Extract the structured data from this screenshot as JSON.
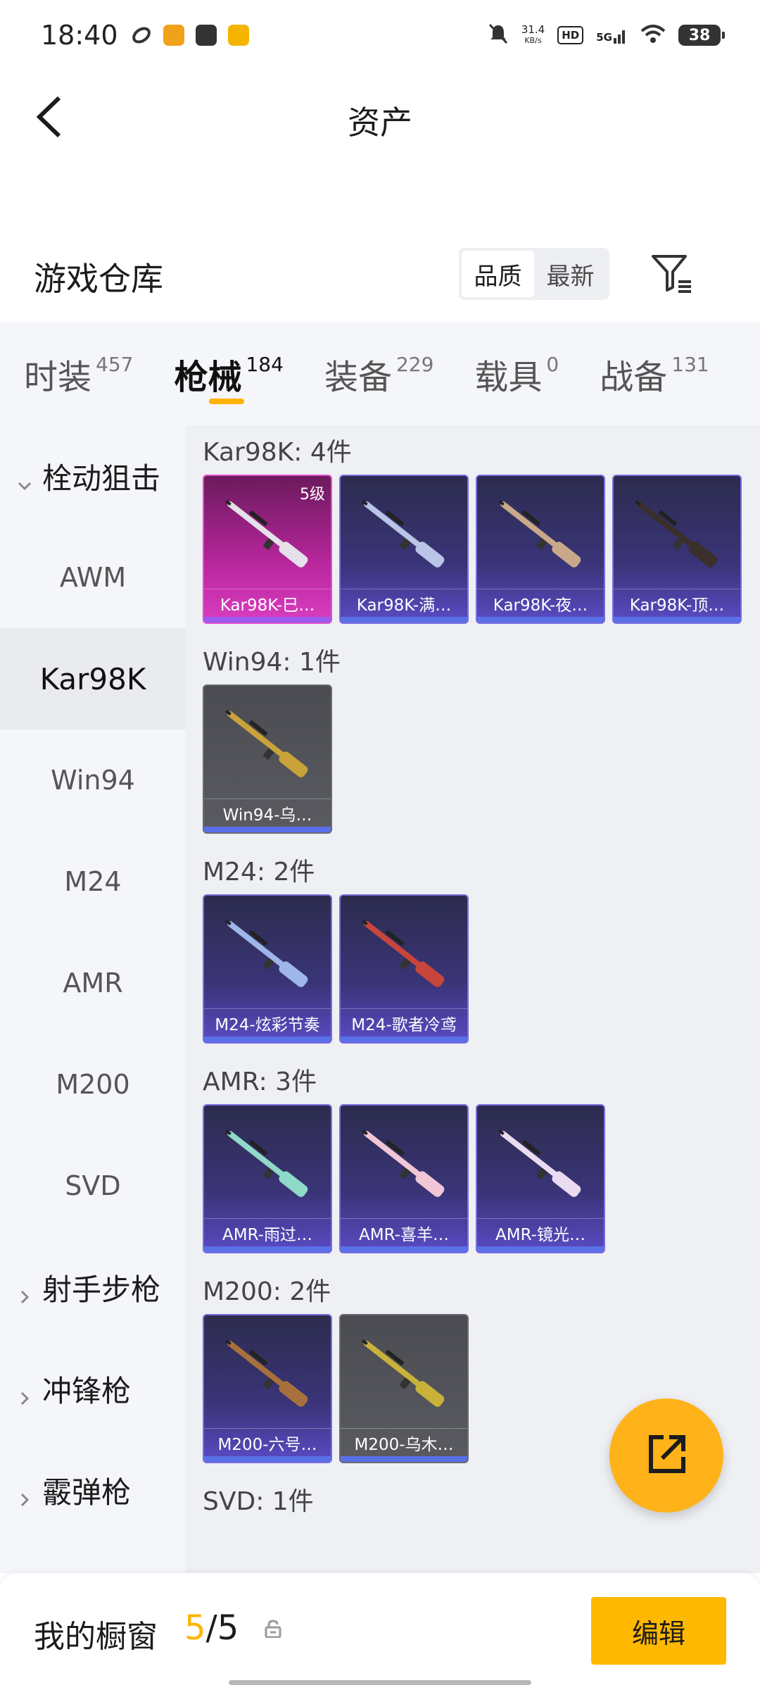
{
  "status_bar": {
    "time": "18:40",
    "speed_value": "31.4",
    "speed_unit": "KB/s",
    "hd": "HD",
    "network": "5G",
    "battery": "38"
  },
  "nav": {
    "title": "资产"
  },
  "warehouse": {
    "title": "游戏仓库",
    "sort_options": [
      "品质",
      "最新"
    ],
    "active_sort": "品质"
  },
  "categories": [
    {
      "label": "时装",
      "count": "457"
    },
    {
      "label": "枪械",
      "count": "184",
      "active": true
    },
    {
      "label": "装备",
      "count": "229"
    },
    {
      "label": "载具",
      "count": "0"
    },
    {
      "label": "战备",
      "count": "131"
    }
  ],
  "sidebar": {
    "items": [
      {
        "label": "栓动狙击",
        "group": true,
        "expanded": true
      },
      {
        "label": "AWM"
      },
      {
        "label": "Kar98K",
        "selected": true
      },
      {
        "label": "Win94"
      },
      {
        "label": "M24"
      },
      {
        "label": "AMR"
      },
      {
        "label": "M200"
      },
      {
        "label": "SVD"
      },
      {
        "label": "射手步枪",
        "group": true
      },
      {
        "label": "冲锋枪",
        "group": true
      },
      {
        "label": "霰弹枪",
        "group": true
      }
    ]
  },
  "sections": [
    {
      "title": "Kar98K: 4件",
      "items": [
        {
          "name": "Kar98K-巳…",
          "level": "5级",
          "rarity": "pink",
          "gun_color": "#e6e0ea"
        },
        {
          "name": "Kar98K-满…",
          "rarity": "purple",
          "gun_color": "#b9c4e6"
        },
        {
          "name": "Kar98K-夜…",
          "rarity": "purple",
          "gun_color": "#c9a88a"
        },
        {
          "name": "Kar98K-顶…",
          "rarity": "purple",
          "gun_color": "#3a2f2a"
        }
      ]
    },
    {
      "title": "Win94: 1件",
      "items": [
        {
          "name": "Win94-乌…",
          "rarity": "gray",
          "gun_color": "#c9a23a"
        }
      ]
    },
    {
      "title": "M24: 2件",
      "items": [
        {
          "name": "M24-炫彩节奏",
          "rarity": "purple",
          "gun_color": "#9fb6e8"
        },
        {
          "name": "M24-歌者冷鸢",
          "rarity": "purple",
          "gun_color": "#c8453c"
        }
      ]
    },
    {
      "title": "AMR: 3件",
      "items": [
        {
          "name": "AMR-雨过…",
          "rarity": "purple",
          "gun_color": "#8fd9c9"
        },
        {
          "name": "AMR-喜羊…",
          "rarity": "purple",
          "gun_color": "#f1c6d6"
        },
        {
          "name": "AMR-镜光…",
          "rarity": "purple",
          "gun_color": "#eadcf0"
        }
      ]
    },
    {
      "title": "M200: 2件",
      "items": [
        {
          "name": "M200-六号…",
          "rarity": "purple",
          "gun_color": "#a8703c"
        },
        {
          "name": "M200-乌木…",
          "rarity": "gray",
          "gun_color": "#c8b23a"
        }
      ]
    },
    {
      "title": "SVD: 1件",
      "items": []
    }
  ],
  "showcase": {
    "label": "我的橱窗",
    "current": "5",
    "separator": "/",
    "total": "5",
    "edit_label": "编辑"
  }
}
